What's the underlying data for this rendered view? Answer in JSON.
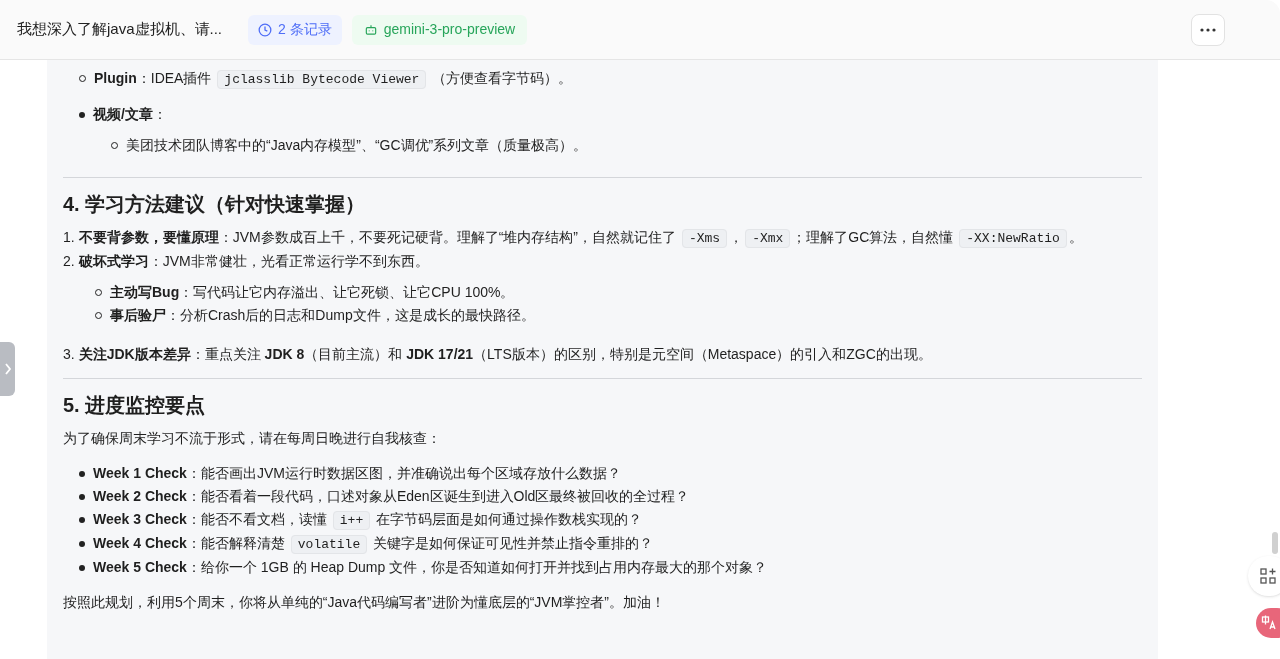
{
  "header": {
    "title": "我想深入了解java虚拟机、请...",
    "records": "2 条记录",
    "model": "gemini-3-pro-preview"
  },
  "blocks": [
    {
      "kind": "sublist",
      "items": [
        {
          "segments": [
            {
              "kind": "text",
              "text": "**Plugin**：IDEA插件 "
            },
            {
              "kind": "code",
              "text": "jclasslib Bytecode Viewer"
            },
            {
              "kind": "text",
              "text": " （方便查看字节码）。"
            }
          ]
        }
      ]
    },
    {
      "kind": "bullets",
      "items": [
        {
          "segments": [
            {
              "kind": "text",
              "text": "**视频/文章**："
            }
          ],
          "children": [
            {
              "segments": [
                {
                  "kind": "text",
                  "text": "美团技术团队博客中的“Java内存模型”、“GC调优”系列文章（质量极高）。"
                }
              ]
            }
          ]
        }
      ]
    },
    {
      "kind": "rule"
    },
    {
      "kind": "heading",
      "text": "4. 学习方法建议（针对快速掌握）"
    },
    {
      "kind": "ordered",
      "items": [
        {
          "number": "1.",
          "segments": [
            {
              "kind": "text",
              "text": "**不要背参数，要懂原理**：JVM参数成百上千，不要死记硬背。理解了“堆内存结构”，自然就记住了 "
            },
            {
              "kind": "code",
              "text": "-Xms"
            },
            {
              "kind": "text",
              "text": "，"
            },
            {
              "kind": "code",
              "text": "-Xmx"
            },
            {
              "kind": "text",
              "text": "；理解了GC算法，自然懂 "
            },
            {
              "kind": "code",
              "text": "-XX:NewRatio"
            },
            {
              "kind": "text",
              "text": "。"
            }
          ]
        },
        {
          "number": "2.",
          "segments": [
            {
              "kind": "text",
              "text": "**破坏式学习**：JVM非常健壮，光看正常运行学不到东西。"
            }
          ],
          "children": [
            {
              "segments": [
                {
                  "kind": "text",
                  "text": "**主动写Bug**：写代码让它内存溢出、让它死锁、让它CPU 100%。"
                }
              ]
            },
            {
              "segments": [
                {
                  "kind": "text",
                  "text": "**事后验尸**：分析Crash后的日志和Dump文件，这是成长的最快路径。"
                }
              ]
            }
          ]
        },
        {
          "number": "3.",
          "segments": [
            {
              "kind": "text",
              "text": "**关注JDK版本差异**：重点关注 **JDK 8**（目前主流）和 **JDK 17/21**（LTS版本）的区别，特别是元空间（Metaspace）的引入和ZGC的出现。"
            }
          ]
        }
      ]
    },
    {
      "kind": "rule"
    },
    {
      "kind": "heading",
      "text": "5. 进度监控要点"
    },
    {
      "kind": "paragraph",
      "segments": [
        {
          "kind": "text",
          "text": "为了确保周末学习不流于形式，请在每周日晚进行自我核查："
        }
      ]
    },
    {
      "kind": "bullets",
      "items": [
        {
          "segments": [
            {
              "kind": "text",
              "text": "**Week 1 Check**：能否画出JVM运行时数据区图，并准确说出每个区域存放什么数据？"
            }
          ]
        },
        {
          "segments": [
            {
              "kind": "text",
              "text": "**Week 2 Check**：能否看着一段代码，口述对象从Eden区诞生到进入Old区最终被回收的全过程？"
            }
          ]
        },
        {
          "segments": [
            {
              "kind": "text",
              "text": "**Week 3 Check**：能否不看文档，读懂 "
            },
            {
              "kind": "code",
              "text": "i++"
            },
            {
              "kind": "text",
              "text": " 在字节码层面是如何通过操作数栈实现的？"
            }
          ]
        },
        {
          "segments": [
            {
              "kind": "text",
              "text": "**Week 4 Check**：能否解释清楚 "
            },
            {
              "kind": "code",
              "text": "volatile"
            },
            {
              "kind": "text",
              "text": " 关键字是如何保证可见性并禁止指令重排的？"
            }
          ]
        },
        {
          "segments": [
            {
              "kind": "text",
              "text": "**Week 5 Check**：给你一个 1GB 的 Heap Dump 文件，你是否知道如何打开并找到占用内存最大的那个对象？"
            }
          ]
        }
      ]
    },
    {
      "kind": "paragraph",
      "segments": [
        {
          "kind": "text",
          "text": "按照此规划，利用5个周末，你将从单纯的“Java代码编写者”进阶为懂底层的“JVM掌控者”。加油！"
        }
      ]
    }
  ]
}
